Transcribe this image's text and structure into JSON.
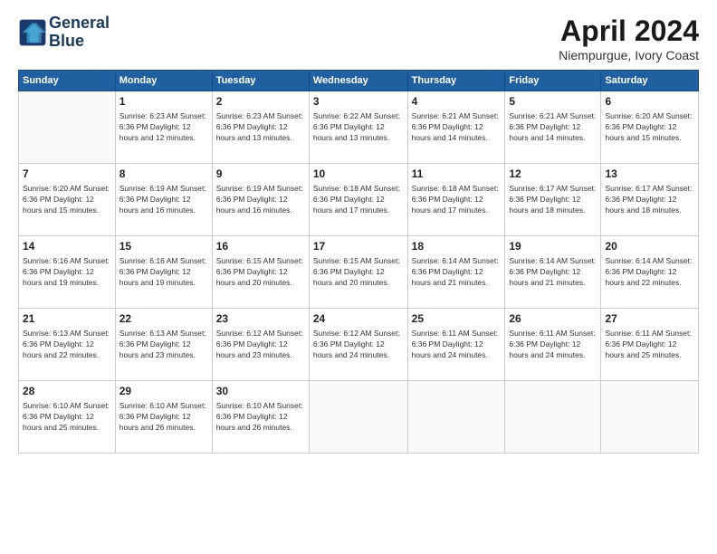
{
  "logo": {
    "line1": "General",
    "line2": "Blue"
  },
  "title": "April 2024",
  "location": "Niempurgue, Ivory Coast",
  "headers": [
    "Sunday",
    "Monday",
    "Tuesday",
    "Wednesday",
    "Thursday",
    "Friday",
    "Saturday"
  ],
  "weeks": [
    [
      {
        "day": "",
        "info": ""
      },
      {
        "day": "1",
        "info": "Sunrise: 6:23 AM\nSunset: 6:36 PM\nDaylight: 12 hours\nand 12 minutes."
      },
      {
        "day": "2",
        "info": "Sunrise: 6:23 AM\nSunset: 6:36 PM\nDaylight: 12 hours\nand 13 minutes."
      },
      {
        "day": "3",
        "info": "Sunrise: 6:22 AM\nSunset: 6:36 PM\nDaylight: 12 hours\nand 13 minutes."
      },
      {
        "day": "4",
        "info": "Sunrise: 6:21 AM\nSunset: 6:36 PM\nDaylight: 12 hours\nand 14 minutes."
      },
      {
        "day": "5",
        "info": "Sunrise: 6:21 AM\nSunset: 6:36 PM\nDaylight: 12 hours\nand 14 minutes."
      },
      {
        "day": "6",
        "info": "Sunrise: 6:20 AM\nSunset: 6:36 PM\nDaylight: 12 hours\nand 15 minutes."
      }
    ],
    [
      {
        "day": "7",
        "info": "Sunrise: 6:20 AM\nSunset: 6:36 PM\nDaylight: 12 hours\nand 15 minutes."
      },
      {
        "day": "8",
        "info": "Sunrise: 6:19 AM\nSunset: 6:36 PM\nDaylight: 12 hours\nand 16 minutes."
      },
      {
        "day": "9",
        "info": "Sunrise: 6:19 AM\nSunset: 6:36 PM\nDaylight: 12 hours\nand 16 minutes."
      },
      {
        "day": "10",
        "info": "Sunrise: 6:18 AM\nSunset: 6:36 PM\nDaylight: 12 hours\nand 17 minutes."
      },
      {
        "day": "11",
        "info": "Sunrise: 6:18 AM\nSunset: 6:36 PM\nDaylight: 12 hours\nand 17 minutes."
      },
      {
        "day": "12",
        "info": "Sunrise: 6:17 AM\nSunset: 6:36 PM\nDaylight: 12 hours\nand 18 minutes."
      },
      {
        "day": "13",
        "info": "Sunrise: 6:17 AM\nSunset: 6:36 PM\nDaylight: 12 hours\nand 18 minutes."
      }
    ],
    [
      {
        "day": "14",
        "info": "Sunrise: 6:16 AM\nSunset: 6:36 PM\nDaylight: 12 hours\nand 19 minutes."
      },
      {
        "day": "15",
        "info": "Sunrise: 6:16 AM\nSunset: 6:36 PM\nDaylight: 12 hours\nand 19 minutes."
      },
      {
        "day": "16",
        "info": "Sunrise: 6:15 AM\nSunset: 6:36 PM\nDaylight: 12 hours\nand 20 minutes."
      },
      {
        "day": "17",
        "info": "Sunrise: 6:15 AM\nSunset: 6:36 PM\nDaylight: 12 hours\nand 20 minutes."
      },
      {
        "day": "18",
        "info": "Sunrise: 6:14 AM\nSunset: 6:36 PM\nDaylight: 12 hours\nand 21 minutes."
      },
      {
        "day": "19",
        "info": "Sunrise: 6:14 AM\nSunset: 6:36 PM\nDaylight: 12 hours\nand 21 minutes."
      },
      {
        "day": "20",
        "info": "Sunrise: 6:14 AM\nSunset: 6:36 PM\nDaylight: 12 hours\nand 22 minutes."
      }
    ],
    [
      {
        "day": "21",
        "info": "Sunrise: 6:13 AM\nSunset: 6:36 PM\nDaylight: 12 hours\nand 22 minutes."
      },
      {
        "day": "22",
        "info": "Sunrise: 6:13 AM\nSunset: 6:36 PM\nDaylight: 12 hours\nand 23 minutes."
      },
      {
        "day": "23",
        "info": "Sunrise: 6:12 AM\nSunset: 6:36 PM\nDaylight: 12 hours\nand 23 minutes."
      },
      {
        "day": "24",
        "info": "Sunrise: 6:12 AM\nSunset: 6:36 PM\nDaylight: 12 hours\nand 24 minutes."
      },
      {
        "day": "25",
        "info": "Sunrise: 6:11 AM\nSunset: 6:36 PM\nDaylight: 12 hours\nand 24 minutes."
      },
      {
        "day": "26",
        "info": "Sunrise: 6:11 AM\nSunset: 6:36 PM\nDaylight: 12 hours\nand 24 minutes."
      },
      {
        "day": "27",
        "info": "Sunrise: 6:11 AM\nSunset: 6:36 PM\nDaylight: 12 hours\nand 25 minutes."
      }
    ],
    [
      {
        "day": "28",
        "info": "Sunrise: 6:10 AM\nSunset: 6:36 PM\nDaylight: 12 hours\nand 25 minutes."
      },
      {
        "day": "29",
        "info": "Sunrise: 6:10 AM\nSunset: 6:36 PM\nDaylight: 12 hours\nand 26 minutes."
      },
      {
        "day": "30",
        "info": "Sunrise: 6:10 AM\nSunset: 6:36 PM\nDaylight: 12 hours\nand 26 minutes."
      },
      {
        "day": "",
        "info": ""
      },
      {
        "day": "",
        "info": ""
      },
      {
        "day": "",
        "info": ""
      },
      {
        "day": "",
        "info": ""
      }
    ]
  ]
}
